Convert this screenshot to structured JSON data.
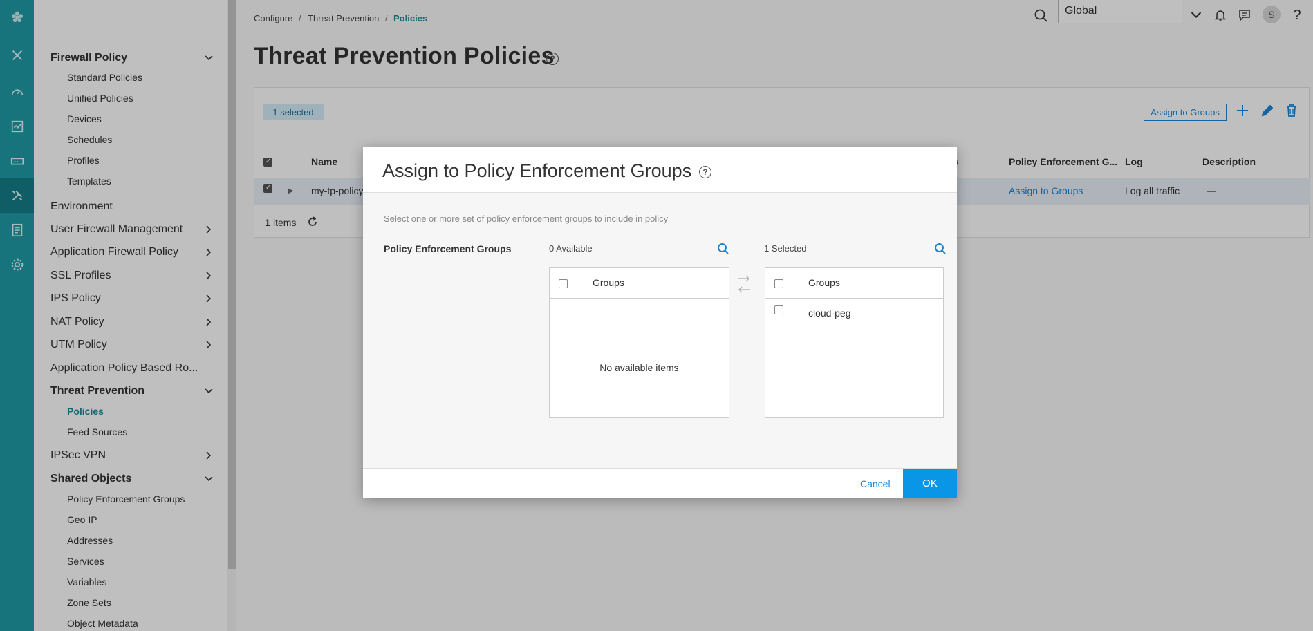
{
  "breadcrumb": {
    "items": [
      "Configure",
      "Threat Prevention",
      "Policies"
    ],
    "separator": "/"
  },
  "header": {
    "scope_value": "Global",
    "avatar_initial": "S",
    "help_glyph": "?"
  },
  "sidebar": {
    "sections": [
      {
        "label": "Firewall Policy",
        "bold": true,
        "expanded": true
      },
      {
        "label": "Environment"
      },
      {
        "label": "User Firewall Management"
      },
      {
        "label": "Application Firewall Policy"
      },
      {
        "label": "SSL Profiles"
      },
      {
        "label": "IPS Policy"
      },
      {
        "label": "NAT Policy"
      },
      {
        "label": "UTM Policy"
      },
      {
        "label": "Application Policy Based Ro..."
      },
      {
        "label": "Threat Prevention",
        "bold": true,
        "expanded": true
      },
      {
        "label": "IPSec VPN"
      },
      {
        "label": "Shared Objects",
        "bold": true,
        "expanded": true
      }
    ],
    "firewall_children": [
      "Standard Policies",
      "Unified Policies",
      "Devices",
      "Schedules",
      "Profiles",
      "Templates"
    ],
    "threat_children": [
      "Policies",
      "Feed Sources"
    ],
    "shared_children": [
      "Policy Enforcement Groups",
      "Geo IP",
      "Addresses",
      "Services",
      "Variables",
      "Zone Sets",
      "Object Metadata"
    ]
  },
  "page": {
    "title": "Threat Prevention Policies",
    "selected_badge": "1 selected",
    "assign_button": "Assign to Groups",
    "columns": [
      "Name",
      "s",
      "Policy Enforcement G...",
      "Log",
      "Description"
    ],
    "row": {
      "name": "my-tp-policy",
      "enforcement": "Assign to Groups",
      "log": "Log all traffic",
      "description": "—"
    },
    "items_count": "1",
    "items_label": "items"
  },
  "modal": {
    "title": "Assign to Policy Enforcement Groups",
    "instruction": "Select one or more set of policy enforcement groups to include in policy",
    "field_label": "Policy Enforcement Groups",
    "available_caption": "0 Available",
    "selected_caption": "1 Selected",
    "column_header": "Groups",
    "empty_message": "No available items",
    "selected_items": [
      "cloud-peg"
    ],
    "cancel_label": "Cancel",
    "ok_label": "OK"
  },
  "colors": {
    "rail": "#1f9ba6",
    "accent": "#1a8a96",
    "link": "#1a86d6",
    "primary_button": "#0a96e6"
  }
}
